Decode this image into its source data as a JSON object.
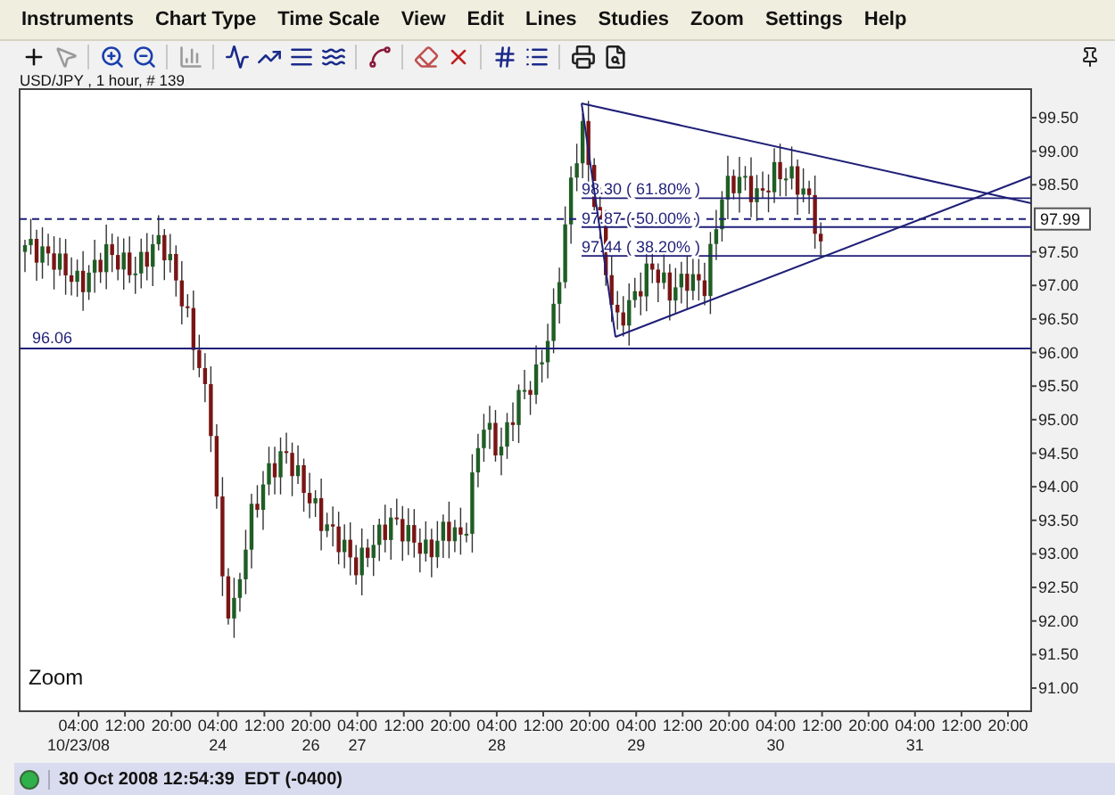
{
  "menu": [
    "Instruments",
    "Chart Type",
    "Time Scale",
    "View",
    "Edit",
    "Lines",
    "Studies",
    "Zoom",
    "Settings",
    "Help"
  ],
  "toolbar": [
    {
      "disabled": false
    },
    {
      "disabled": true
    },
    {
      "disabled": false
    },
    {
      "disabled": false
    },
    {
      "disabled": true
    },
    {
      "disabled": false
    },
    {
      "disabled": false
    },
    {
      "disabled": false
    },
    {
      "disabled": false
    },
    {
      "disabled": false
    },
    {
      "disabled": false
    },
    {
      "disabled": false
    },
    {
      "disabled": false
    },
    {
      "disabled": false
    },
    {
      "disabled": false
    },
    {
      "disabled": false
    }
  ],
  "chart": {
    "instrument": "USD/JPY , 1 hour, # 139",
    "zoom_label": "Zoom",
    "yticks": [
      "99.50",
      "99.00",
      "98.50",
      "97.50",
      "97.00",
      "96.50",
      "96.00",
      "95.50",
      "95.00",
      "94.50",
      "94.00",
      "93.50",
      "93.00",
      "92.50",
      "92.00",
      "91.50",
      "91.00"
    ],
    "current_price": "97.99",
    "support_label": "96.06",
    "fib_levels": [
      "98.30 ( 61.80% )",
      "97.87 ( 50.00% )",
      "97.44 ( 38.20% )"
    ],
    "xticks": [
      {
        "time": "04:00",
        "date": "10/23/08"
      },
      {
        "time": "12:00"
      },
      {
        "time": "20:00"
      },
      {
        "time": "04:00",
        "date": "24"
      },
      {
        "time": "12:00"
      },
      {
        "time": "20:00",
        "date": "26"
      },
      {
        "time": "04:00",
        "date": "27"
      },
      {
        "time": "12:00"
      },
      {
        "time": "20:00"
      },
      {
        "time": "04:00",
        "date": "28"
      },
      {
        "time": "12:00"
      },
      {
        "time": "20:00"
      },
      {
        "time": "04:00",
        "date": "29"
      },
      {
        "time": "12:00"
      },
      {
        "time": "20:00"
      },
      {
        "time": "04:00",
        "date": "30"
      },
      {
        "time": "12:00"
      },
      {
        "time": "20:00"
      },
      {
        "time": "04:00",
        "date": "31"
      },
      {
        "time": "12:00"
      },
      {
        "time": "20:00"
      }
    ]
  },
  "status": {
    "connected": true,
    "text": "30 Oct 2008 12:54:39  EDT (-0400)"
  }
}
